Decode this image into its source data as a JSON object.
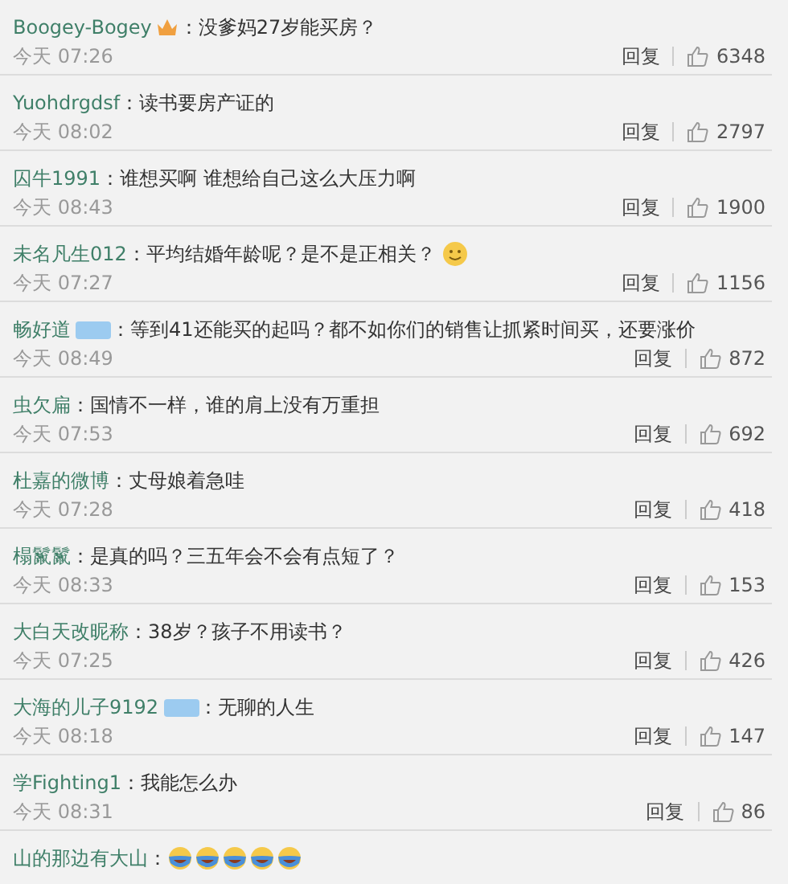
{
  "comments": [
    {
      "user": "Boogey-Bogey",
      "crown_badge": true,
      "member_badge": false,
      "kind": "text",
      "text": "：没爹妈27岁能买房？",
      "time": "今天 07:26",
      "reply": "回复",
      "likes": "6348"
    },
    {
      "user": "Yuohdrgdsf",
      "crown_badge": false,
      "member_badge": false,
      "kind": "text",
      "text": "：读书要房产证的",
      "time": "今天 08:02",
      "reply": "回复",
      "likes": "2797"
    },
    {
      "user": "囚牛1991",
      "crown_badge": false,
      "member_badge": false,
      "kind": "text",
      "text": "：谁想买啊 谁想给自己这么大压力啊",
      "time": "今天 08:43",
      "reply": "回复",
      "likes": "1900"
    },
    {
      "user": "未名凡生012",
      "crown_badge": false,
      "member_badge": false,
      "kind": "text_emoji",
      "text": "：平均结婚年龄呢？是不是正相关？",
      "time": "今天 07:27",
      "reply": "回复",
      "likes": "1156"
    },
    {
      "user": "畅好道",
      "crown_badge": false,
      "member_badge": true,
      "kind": "text",
      "text": "：等到41还能买的起吗？都不如你们的销售让抓紧时间买，还要涨价",
      "time": "今天 08:49",
      "reply": "回复",
      "likes": "872"
    },
    {
      "user": "虫欠扁",
      "crown_badge": false,
      "member_badge": false,
      "kind": "text",
      "text": "：国情不一样，谁的肩上没有万重担",
      "time": "今天 07:53",
      "reply": "回复",
      "likes": "692"
    },
    {
      "user": "杜嘉的微博",
      "crown_badge": false,
      "member_badge": false,
      "kind": "text",
      "text": "：丈母娘着急哇",
      "time": "今天 07:28",
      "reply": "回复",
      "likes": "418"
    },
    {
      "user": "榻鬣鬣",
      "crown_badge": false,
      "member_badge": false,
      "kind": "text",
      "text": "：是真的吗？三五年会不会有点短了？",
      "time": "今天 08:33",
      "reply": "回复",
      "likes": "153"
    },
    {
      "user": "大白天改昵称",
      "crown_badge": false,
      "member_badge": false,
      "kind": "text",
      "text": "：38岁？孩子不用读书？",
      "time": "今天 07:25",
      "reply": "回复",
      "likes": "426"
    },
    {
      "user": "大海的儿子9192",
      "crown_badge": false,
      "member_badge": true,
      "kind": "text",
      "text": "：无聊的人生",
      "time": "今天 08:18",
      "reply": "回复",
      "likes": "147"
    },
    {
      "user": "学Fighting1",
      "crown_badge": false,
      "member_badge": false,
      "kind": "text",
      "text": "：我能怎么办",
      "time": "今天 08:31",
      "reply": "回复",
      "likes": "86"
    },
    {
      "user": "山的那边有大山",
      "crown_badge": false,
      "member_badge": false,
      "kind": "emoji_only",
      "text": "："
    }
  ]
}
